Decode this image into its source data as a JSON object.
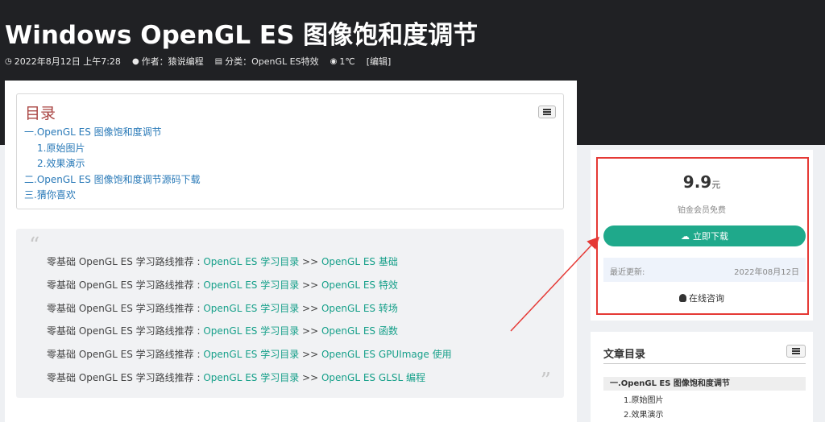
{
  "article": {
    "title": "Windows OpenGL ES 图像饱和度调节",
    "meta": {
      "date": "2022年8月12日 上午7:28",
      "author": "作者：猿说编程",
      "category": "分类：OpenGL ES特效",
      "views": "1℃",
      "edit": "[编辑]"
    }
  },
  "toc": {
    "title": "目录",
    "items": [
      "一.OpenGL ES 图像饱和度调节",
      "1.原始图片",
      "2.效果演示",
      "二.OpenGL ES 图像饱和度调节源码下载",
      "三.猜你喜欢"
    ]
  },
  "quote": {
    "open": "“",
    "close": "”",
    "prefix": "零基础 OpenGL ES 学习路线推荐 : ",
    "lines": [
      {
        "link1": "OpenGL ES 学习目录",
        "sep": " >> ",
        "link2": "OpenGL ES 基础"
      },
      {
        "link1": "OpenGL ES 学习目录",
        "sep": "  >> ",
        "link2": "OpenGL ES 特效"
      },
      {
        "link1": "OpenGL ES 学习目录",
        "sep": "  >> ",
        "link2": "OpenGL ES 转场"
      },
      {
        "link1": " OpenGL ES 学习目录",
        "sep": " >> ",
        "link2": "OpenGL ES 函数"
      },
      {
        "link1": " OpenGL ES 学习目录",
        "sep": " >> ",
        "link2": "OpenGL ES GPUImage 使用"
      },
      {
        "link1": " OpenGL ES 学习目录",
        "sep": " >> ",
        "link2": "OpenGL ES GLSL 编程"
      }
    ]
  },
  "purchase": {
    "price": "9.9",
    "unit": "元",
    "member": "铂金会员免费",
    "download": "立即下载",
    "update_label": "最近更新:",
    "update_date": "2022年08月12日",
    "consult": "在线咨询"
  },
  "side_toc": {
    "title": "文章目录",
    "active": "一.OpenGL ES 图像饱和度调节",
    "subs": [
      "1.原始图片",
      "2.效果演示"
    ]
  },
  "colors": {
    "hero_bg": "#202124",
    "accent": "#1fa98b",
    "link": "#2a7ab8",
    "highlight": "#e53935"
  }
}
